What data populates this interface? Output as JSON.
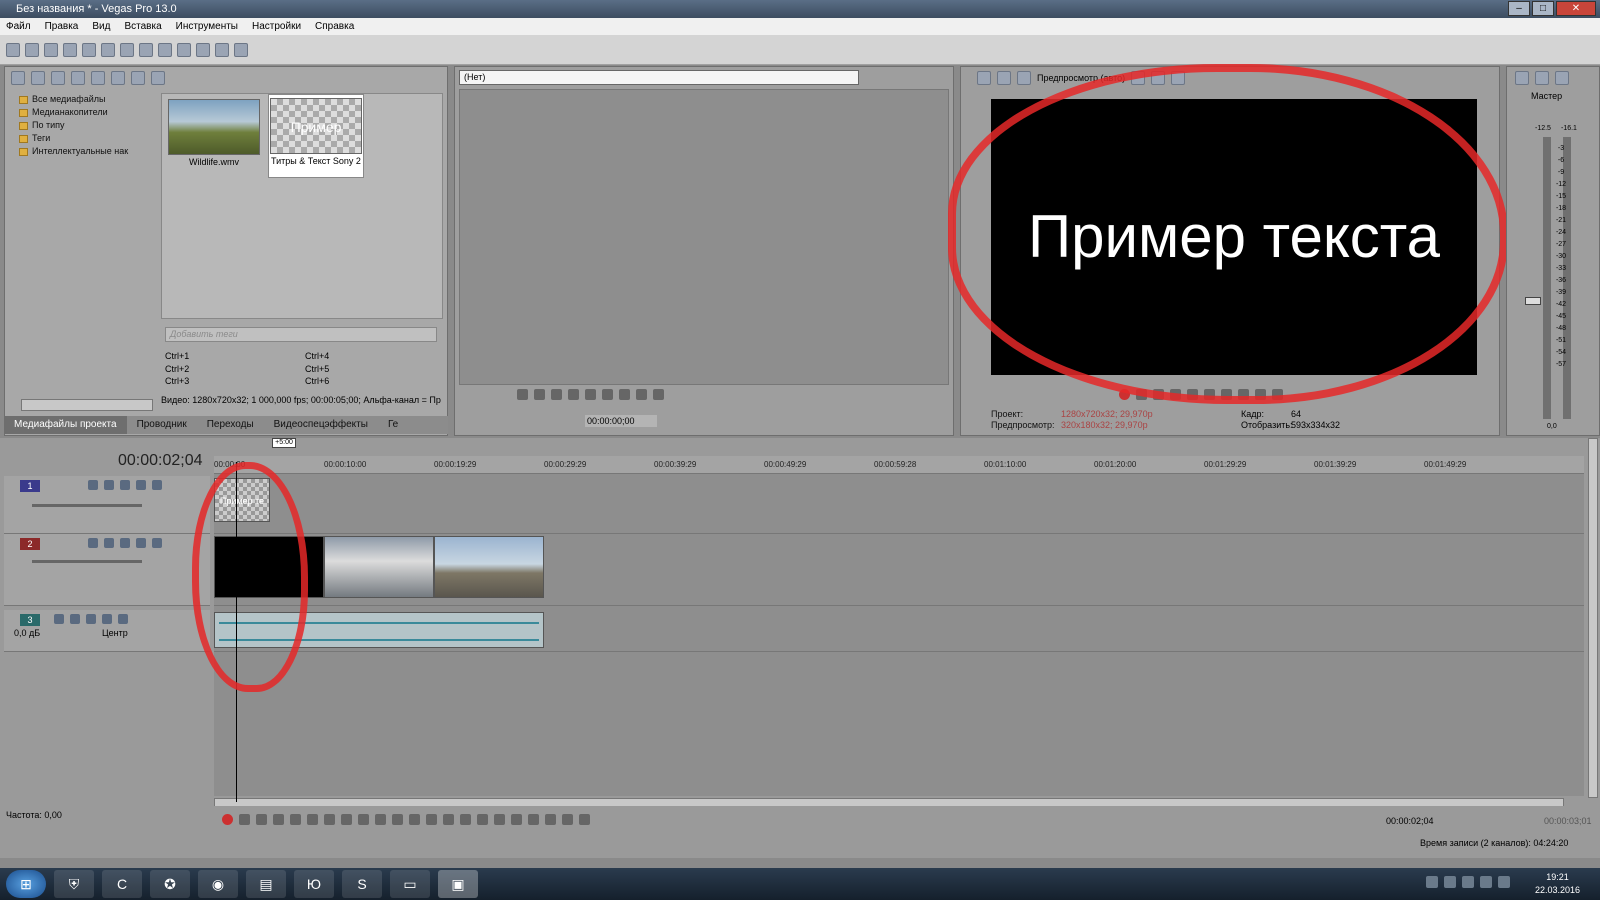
{
  "window": {
    "title": "Без названия * - Vegas Pro 13.0"
  },
  "menu": [
    "Файл",
    "Правка",
    "Вид",
    "Вставка",
    "Инструменты",
    "Настройки",
    "Справка"
  ],
  "explorer": {
    "tree": [
      "Все медиафайлы",
      "Медианакопители",
      "По типу",
      "Теги",
      "Интеллектуальные нак"
    ],
    "media": [
      {
        "name": "Wildlife.wmv",
        "label": ""
      },
      {
        "name": "Титры & Текст Sony 2",
        "label": "Пример текста"
      }
    ],
    "tags_placeholder": "Добавить теги",
    "shortcuts": [
      [
        "Ctrl+1",
        "Ctrl+4"
      ],
      [
        "Ctrl+2",
        "Ctrl+5"
      ],
      [
        "Ctrl+3",
        "Ctrl+6"
      ]
    ],
    "info": "Видео: 1280x720x32; 1 000,000 fps; 00:00:05;00; Альфа-канал = Пр",
    "tabs": [
      "Медиафайлы проекта",
      "Проводник",
      "Переходы",
      "Видеоспецэффекты",
      "Ге"
    ]
  },
  "trimmer": {
    "select": "(Нет)",
    "time": "00:00:00;00"
  },
  "preview": {
    "mode": "Предпросмотр (авто)",
    "screen_text": "Пример текста",
    "info": {
      "project_label": "Проект:",
      "project_value": "1280x720x32; 29,970p",
      "preview_label": "Предпросмотр:",
      "preview_value": "320x180x32; 29,970p",
      "frame_label": "Кадр:",
      "frame_value": "64",
      "display_label": "Отобразить:",
      "display_value": "593x334x32"
    }
  },
  "master": {
    "label": "Мастер",
    "scale": [
      "-3",
      "-6",
      "-9",
      "-12",
      "-15",
      "-18",
      "-21",
      "-24",
      "-27",
      "-30",
      "-33",
      "-36",
      "-39",
      "-42",
      "-45",
      "-48",
      "-51",
      "-54",
      "-57"
    ],
    "top_l": "-12.5",
    "top_r": "-16.1",
    "bottom": "0,0"
  },
  "timeline": {
    "time": "00:00:02;04",
    "region": "+5:00",
    "ruler": [
      "00:00:00",
      "00:00:10:00",
      "00:00:19:29",
      "00:00:29:29",
      "00:00:39:29",
      "00:00:49:29",
      "00:00:59:28",
      "00:01:10:00",
      "00:01:20:00",
      "00:01:29:29",
      "00:01:39:29",
      "00:01:49:29"
    ],
    "tracks": [
      {
        "num": "1"
      },
      {
        "num": "2"
      },
      {
        "num": "3",
        "gain": "0,0 дБ",
        "pan": "Центр"
      }
    ],
    "title_clip": "Пример те"
  },
  "bottom": {
    "freq": "Частота: 0,00",
    "time": "00:00:02;04",
    "time_end": "00:00:03;01",
    "record": "Время записи (2 каналов): 04:24:20"
  },
  "taskbar": {
    "time": "19:21",
    "date": "22.03.2016"
  }
}
